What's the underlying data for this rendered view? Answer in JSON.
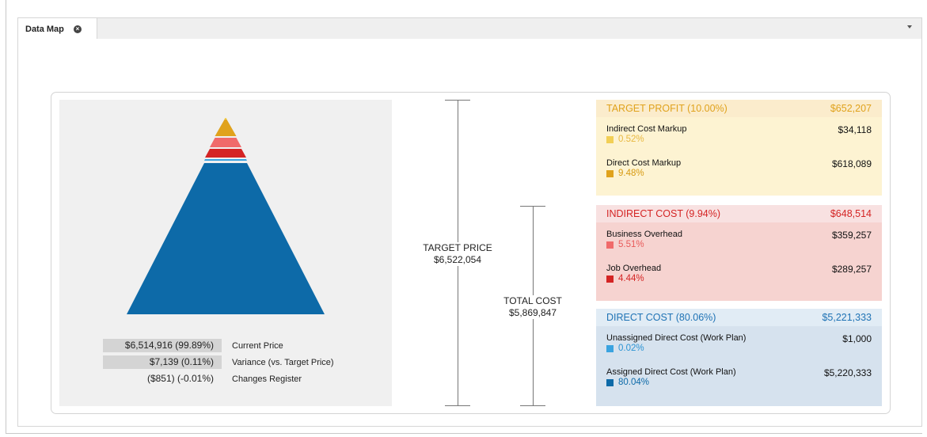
{
  "tab": {
    "title": "Data Map",
    "close_icon": "×"
  },
  "legend": [
    {
      "value": "$6,514,916 (99.89%)",
      "label": "Current Price",
      "shaded": true
    },
    {
      "value": "$7,139 (0.11%)",
      "label": "Variance (vs. Target Price)",
      "shaded": true
    },
    {
      "value": "($851) (-0.01%)",
      "label": "Changes Register",
      "shaded": false
    }
  ],
  "target_price": {
    "label": "TARGET PRICE",
    "value": "$6,522,054"
  },
  "total_cost": {
    "label": "TOTAL COST",
    "value": "$5,869,847"
  },
  "sections": {
    "target_profit": {
      "title": "TARGET PROFIT (10.00%)",
      "total": "$652,207",
      "items": [
        {
          "label": "Indirect Cost Markup",
          "value": "$34,118",
          "pct": "0.52%",
          "color": "#f2cf55"
        },
        {
          "label": "Direct Cost Markup",
          "value": "$618,089",
          "pct": "9.48%",
          "color": "#e0a21c"
        }
      ]
    },
    "indirect_cost": {
      "title": "INDIRECT COST (9.94%)",
      "total": "$648,514",
      "items": [
        {
          "label": "Business Overhead",
          "value": "$359,257",
          "pct": "5.51%",
          "color": "#f06a6a"
        },
        {
          "label": "Job Overhead",
          "value": "$289,257",
          "pct": "4.44%",
          "color": "#d42424"
        }
      ]
    },
    "direct_cost": {
      "title": "DIRECT COST (80.06%)",
      "total": "$5,221,333",
      "items": [
        {
          "label": "Unassigned Direct Cost (Work Plan)",
          "value": "$1,000",
          "pct": "0.02%",
          "color": "#3aa3e0"
        },
        {
          "label": "Assigned Direct Cost (Work Plan)",
          "value": "$5,220,333",
          "pct": "80.04%",
          "color": "#0d6aa8"
        }
      ]
    }
  },
  "colors": {
    "profit_head_bg": "#fbeccc",
    "profit_body_bg": "#fdf3d2",
    "profit_text": "#e0a21c",
    "indirect_head_bg": "#f8e1e1",
    "indirect_body_bg": "#f6d3d0",
    "indirect_text": "#d42424",
    "direct_head_bg": "#e1ecf5",
    "direct_body_bg": "#d6e2ee",
    "direct_text": "#1f73b5"
  }
}
